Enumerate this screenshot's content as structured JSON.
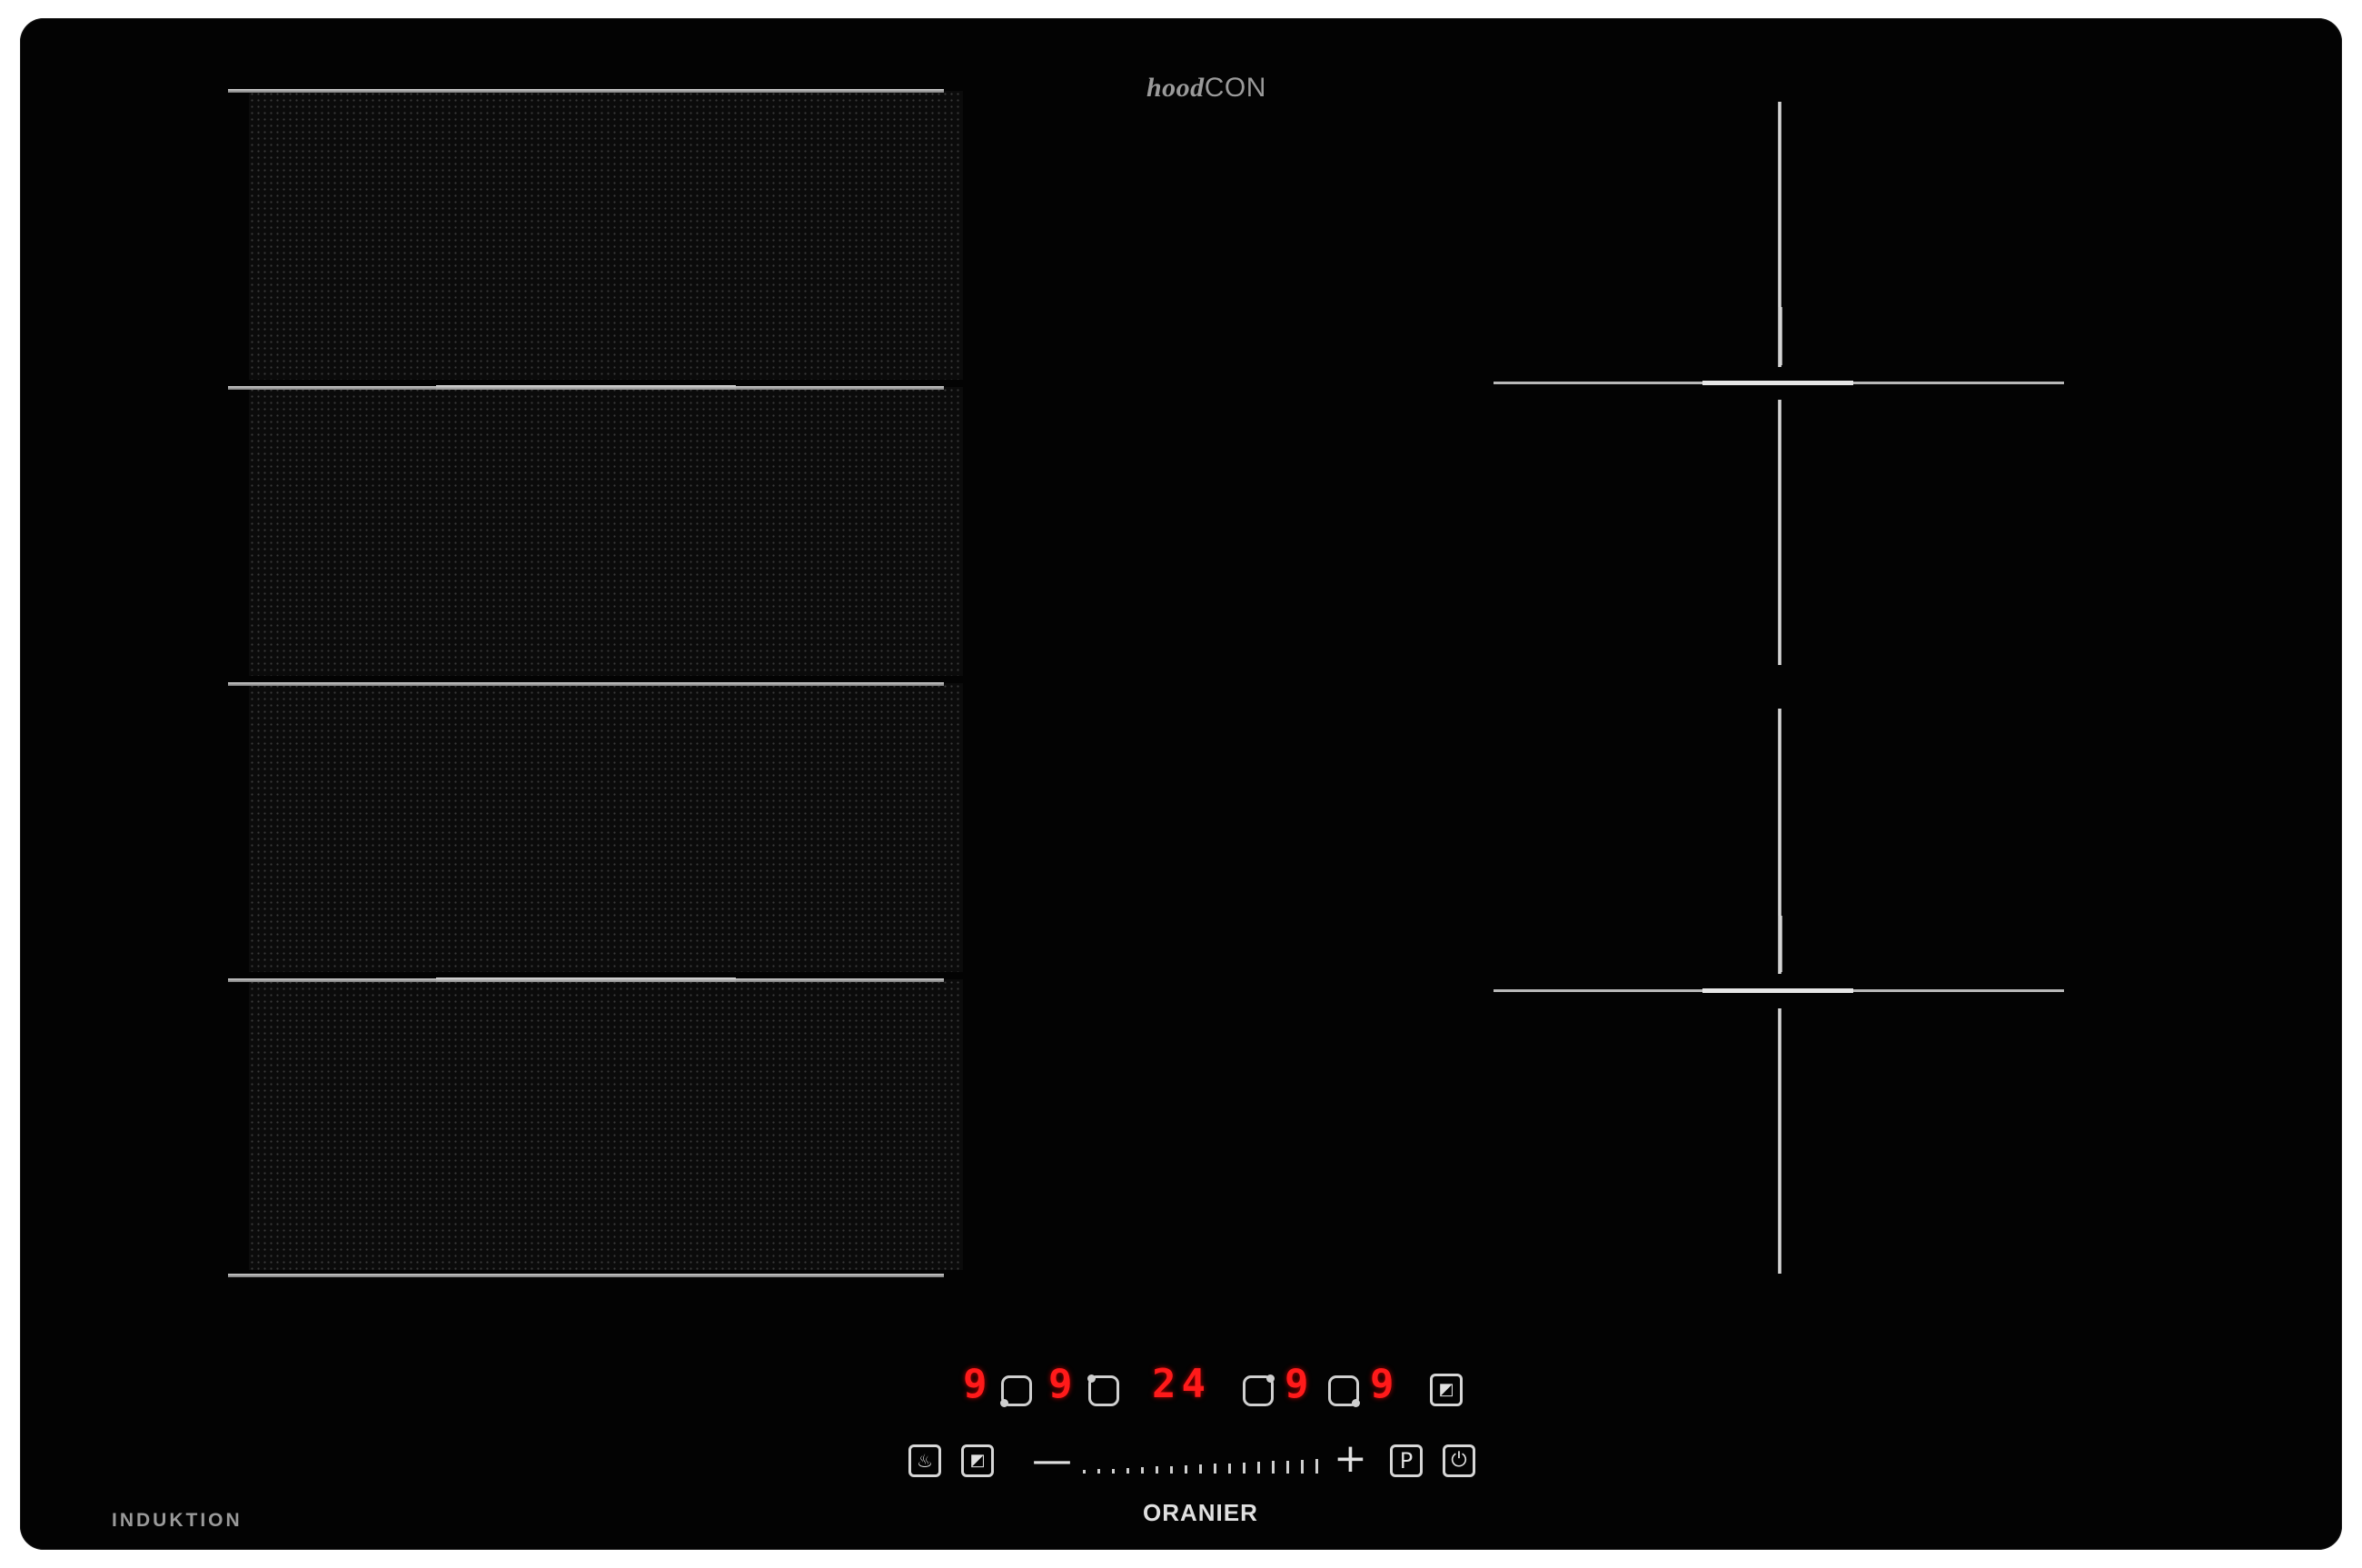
{
  "brand": {
    "hood": "hood",
    "con": "CON",
    "bottom": "ORANIER",
    "type_label": "INDUKTION"
  },
  "display": {
    "d1": "9",
    "d2": "9",
    "timer": "24",
    "d3": "9",
    "d4": "9"
  },
  "controls": {
    "minus": "—",
    "plus": "+",
    "power_levels": 17,
    "pause_label": "P"
  },
  "colors": {
    "glass": "#030303",
    "display_red": "#ff1a1a",
    "lines": "#cfcfcf"
  }
}
